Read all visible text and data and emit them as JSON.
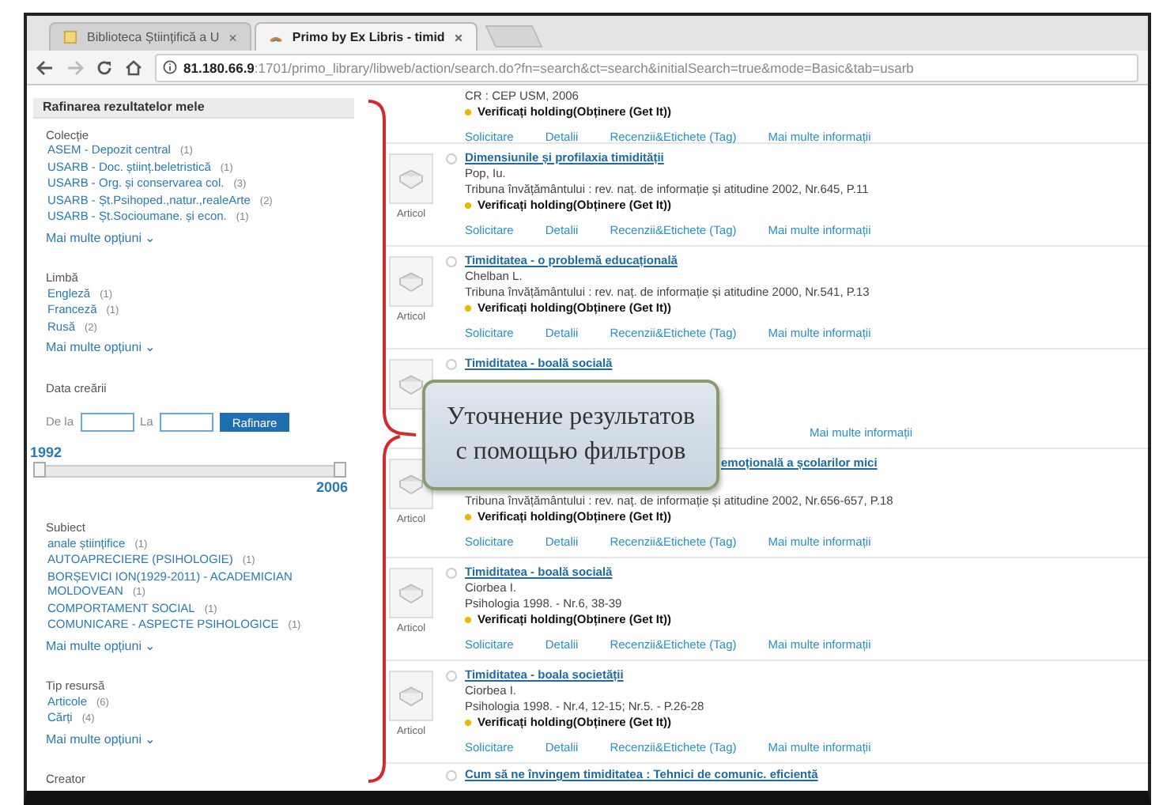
{
  "browser": {
    "tabs": [
      {
        "title": "Biblioteca Științifică a U",
        "close": "×",
        "selected": false
      },
      {
        "title": "Primo by Ex Libris - timid",
        "close": "×",
        "selected": true
      }
    ],
    "url_host": "81.180.66.9",
    "url_path": ":1701/primo_library/libweb/action/search.do?fn=search&ct=search&initialSearch=true&mode=Basic&tab=usarb"
  },
  "sidebar": {
    "title": "Rafinarea rezultatelor mele",
    "groups": [
      {
        "kind": "list",
        "title": "Colecție",
        "options": [
          {
            "label": "ASEM - Depozit central",
            "count": "(1)"
          },
          {
            "label": "USARB - Doc. științ.beletristică",
            "count": "(1)"
          },
          {
            "label": "USARB - Org. și conservarea col.",
            "count": "(3)"
          },
          {
            "label": "USARB - Șt.Psihoped.,natur.,realeArte",
            "count": "(2)"
          },
          {
            "label": "USARB - Șt.Socioumane. și econ.",
            "count": "(1)"
          }
        ],
        "more": "Mai multe opțiuni ⌄"
      },
      {
        "kind": "list",
        "title": "Limbă",
        "options": [
          {
            "label": "Engleză",
            "count": "(1)"
          },
          {
            "label": "Franceză",
            "count": "(1)"
          },
          {
            "label": "Rusă",
            "count": "(2)"
          }
        ],
        "more": "Mai multe opțiuni ⌄"
      },
      {
        "kind": "date",
        "title": "Data creării",
        "from_label": "De la",
        "to_label": "La",
        "button": "Rafinare",
        "min": "1992",
        "max": "2006",
        "level": 1
      },
      {
        "kind": "list",
        "title": "Subiect",
        "options": [
          {
            "label": "anale științifice",
            "count": "(1)"
          },
          {
            "label": "AUTOAPRECIERE (PSIHOLOGIE)",
            "count": "(1)"
          },
          {
            "label": "BORȘEVICI ION(1929-2011) - ACADEMICIAN MOLDOVEAN",
            "count": "(1)"
          },
          {
            "label": "COMPORTAMENT SOCIAL",
            "count": "(1)"
          },
          {
            "label": "COMUNICARE - ASPECTE PSIHOLOGICE",
            "count": "(1)"
          }
        ],
        "more": "Mai multe opțiuni ⌄"
      },
      {
        "kind": "list",
        "title": "Tip resursă",
        "options": [
          {
            "label": "Articole",
            "count": "(6)"
          },
          {
            "label": "Cărți",
            "count": "(4)"
          }
        ],
        "more": "Mai multe opțiuni ⌄"
      },
      {
        "kind": "cut",
        "title": "Creator"
      }
    ]
  },
  "results": [
    {
      "kind": "tail",
      "source": "CR : CEP USM, 2006",
      "holding": "Verificați holding(Obținere (Get It))",
      "actions": [
        "Solicitare",
        "Detalii",
        "Recenzii&Etichete (Tag)",
        "Mai multe informații"
      ]
    },
    {
      "kind": "full",
      "type_label": "Articol",
      "title": "Dimensiunile și profilaxia timidității",
      "author": "Pop, Iu.",
      "source": "Tribuna învățământului : rev. naț. de informație și atitudine 2002, Nr.645, P.11",
      "holding": "Verificați holding(Obținere (Get It))",
      "actions": [
        "Solicitare",
        "Detalii",
        "Recenzii&Etichete (Tag)",
        "Mai multe informații"
      ]
    },
    {
      "kind": "full",
      "type_label": "Articol",
      "title": "Timiditatea - o problemă educațională",
      "author": "Chelban L.",
      "source": "Tribuna învățământului : rev. naț. de informație și atitudine 2000, Nr.541, P.13",
      "holding": "Verificați holding(Obținere (Get It))",
      "actions": [
        "Solicitare",
        "Detalii",
        "Recenzii&Etichete (Tag)",
        "Mai multe informații"
      ]
    },
    {
      "kind": "partial",
      "title": "Timiditatea - boală socială",
      "actions": [
        "Mai multe informații"
      ]
    },
    {
      "kind": "overlap",
      "type_label": "Articol",
      "title": "emoțională a școlarilor mici",
      "source": "Tribuna învățământului : rev. naț. de informație și atitudine 2002, Nr.656-657, P.18",
      "holding": "Verificați holding(Obținere (Get It))",
      "actions": [
        "Solicitare",
        "Detalii",
        "Recenzii&Etichete (Tag)",
        "Mai multe informații"
      ]
    },
    {
      "kind": "full",
      "type_label": "Articol",
      "title": "Timiditatea - boală socială",
      "author": "Ciorbea I.",
      "source": "Psihologia 1998. - Nr.6, 38-39",
      "holding": "Verificați holding(Obținere (Get It))",
      "actions": [
        "Solicitare",
        "Detalii",
        "Recenzii&Etichete (Tag)",
        "Mai multe informații"
      ]
    },
    {
      "kind": "full",
      "type_label": "Articol",
      "title": "Timiditatea - boala societății",
      "author": "Ciorbea I.",
      "source": "Psihologia 1998. - Nr.4, 12-15; Nr.5. - P.26-28",
      "holding": "Verificați holding(Obținere (Get It))",
      "actions": [
        "Solicitare",
        "Detalii",
        "Recenzii&Etichete (Tag)",
        "Mai multe informații"
      ]
    },
    {
      "kind": "cut",
      "title": "Cum să ne învingem timiditatea : Tehnici de comunic. eficientă"
    }
  ],
  "callout": {
    "text": "Уточнение результатов с помощью фильтров"
  }
}
